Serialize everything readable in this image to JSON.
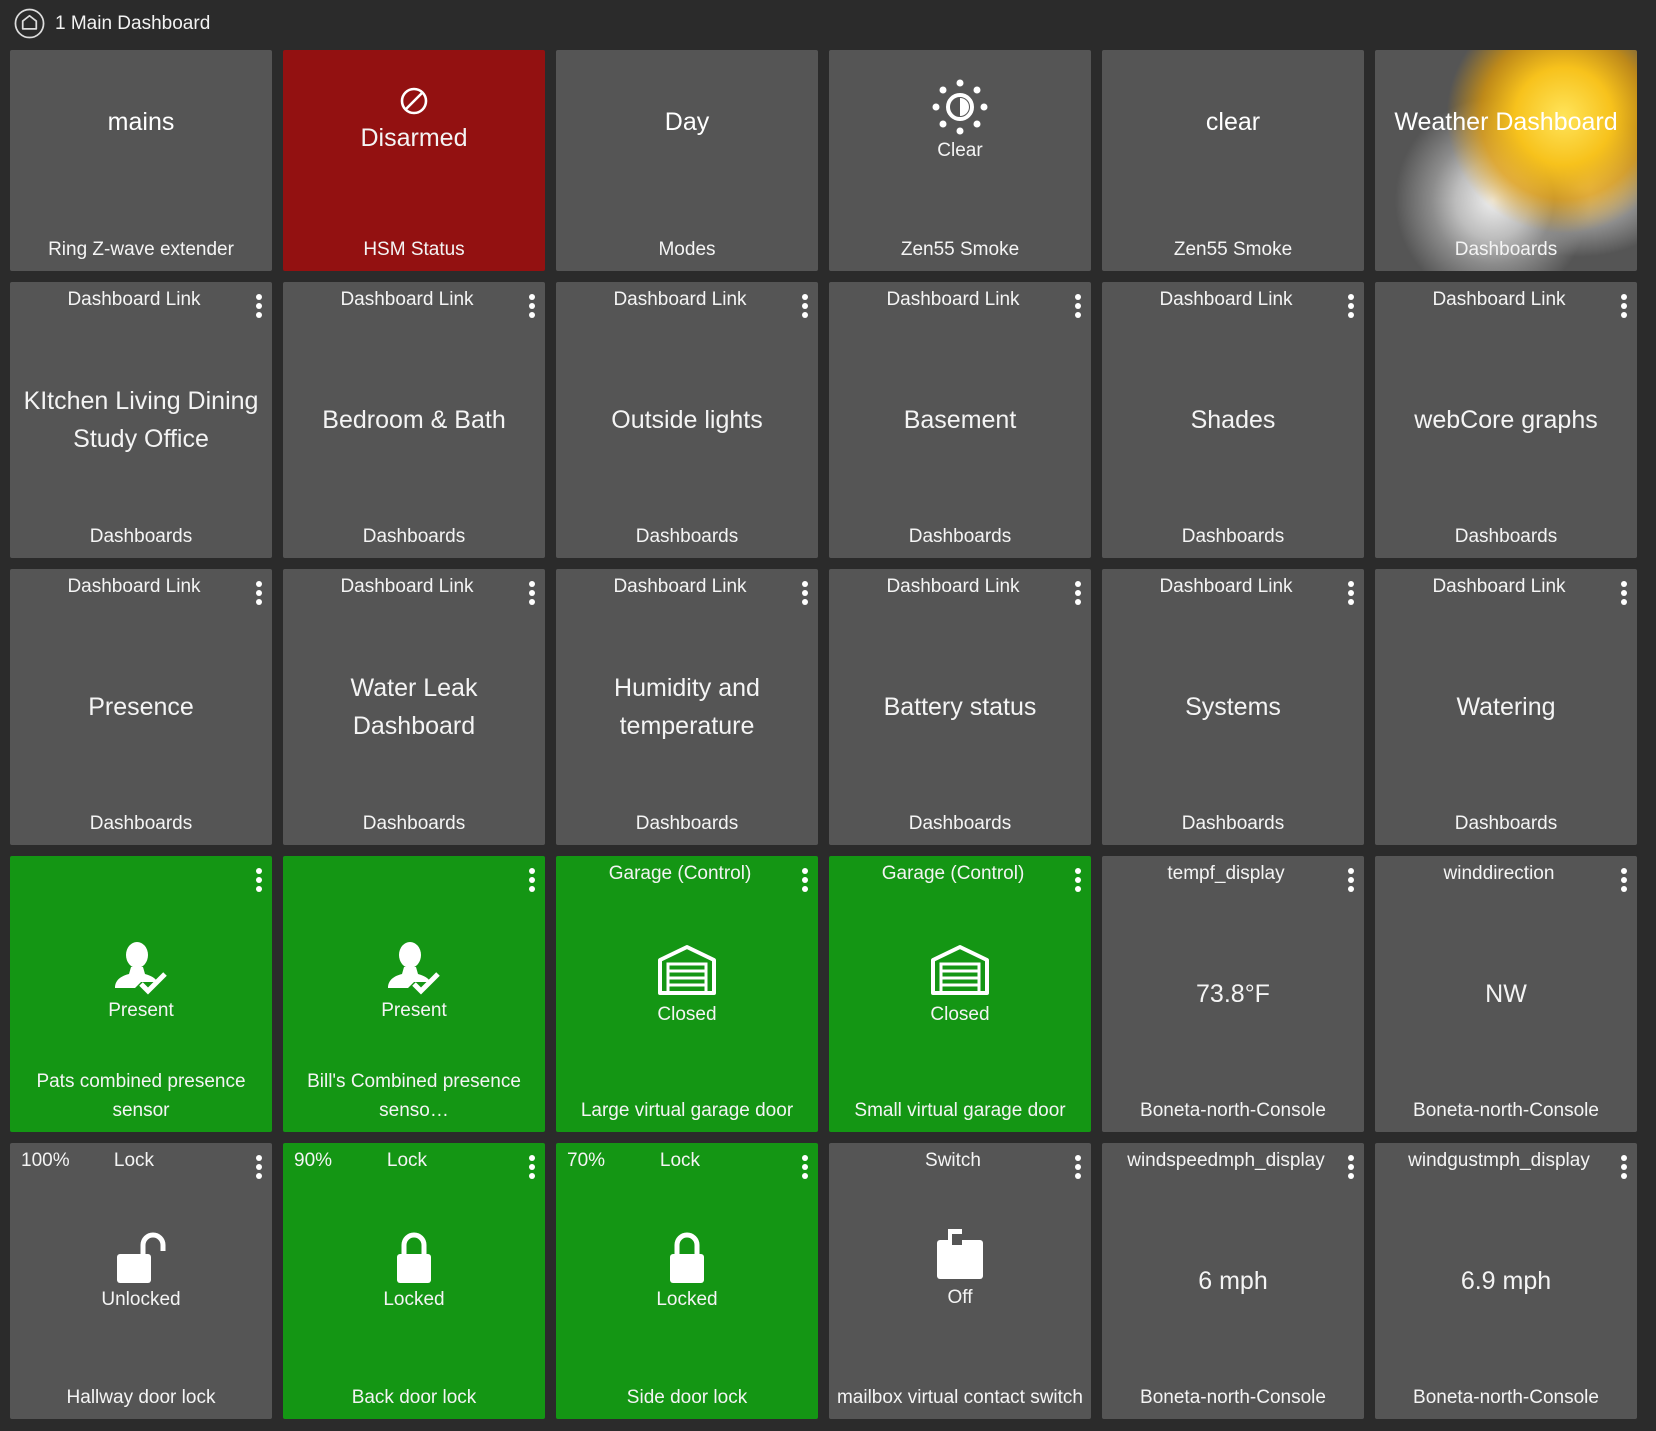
{
  "header": {
    "title": "1 Main Dashboard",
    "icon": "home-icon"
  },
  "tiles": {
    "t1": {
      "state": "mains",
      "name": "Ring Z-wave extender"
    },
    "t2": {
      "state": "Disarmed",
      "name": "HSM Status",
      "icon": "disarmed-icon",
      "color": "#931111"
    },
    "t3": {
      "state": "Day",
      "name": "Modes"
    },
    "t4": {
      "state": "Clear",
      "name": "Zen55 Smoke",
      "icon": "sun-icon"
    },
    "t5": {
      "state": "clear",
      "name": "Zen55 Smoke"
    },
    "t6": {
      "state": "Weather Dashboard",
      "name": "Dashboards",
      "icon": "weather-image"
    },
    "t7": {
      "label": "Dashboard Link",
      "state": "KItchen Living Dining Study Office",
      "name": "Dashboards"
    },
    "t8": {
      "label": "Dashboard Link",
      "state": "Bedroom & Bath",
      "name": "Dashboards"
    },
    "t9": {
      "label": "Dashboard Link",
      "state": "Outside lights",
      "name": "Dashboards"
    },
    "t10": {
      "label": "Dashboard Link",
      "state": "Basement",
      "name": "Dashboards"
    },
    "t11": {
      "label": "Dashboard Link",
      "state": "Shades",
      "name": "Dashboards"
    },
    "t12": {
      "label": "Dashboard Link",
      "state": "webCore graphs",
      "name": "Dashboards"
    },
    "t13": {
      "label": "Dashboard Link",
      "state": "Presence",
      "name": "Dashboards"
    },
    "t14": {
      "label": "Dashboard Link",
      "state": "Water Leak Dashboard",
      "name": "Dashboards"
    },
    "t15": {
      "label": "Dashboard Link",
      "state": "Humidity and temperature",
      "name": "Dashboards"
    },
    "t16": {
      "label": "Dashboard Link",
      "state": "Battery status",
      "name": "Dashboards"
    },
    "t17": {
      "label": "Dashboard Link",
      "state": "Systems",
      "name": "Dashboards"
    },
    "t18": {
      "label": "Dashboard Link",
      "state": "Watering",
      "name": "Dashboards"
    },
    "t19": {
      "state": "Present",
      "name": "Pats combined presence sensor",
      "icon": "person-check-icon",
      "color": "#149614"
    },
    "t20": {
      "state": "Present",
      "name": "Bill's Combined presence senso…",
      "icon": "person-check-icon",
      "color": "#149614"
    },
    "t21": {
      "label": "Garage (Control)",
      "state": "Closed",
      "name": "Large virtual garage door",
      "icon": "garage-icon",
      "color": "#149614"
    },
    "t22": {
      "label": "Garage (Control)",
      "state": "Closed",
      "name": "Small virtual garage door",
      "icon": "garage-icon",
      "color": "#149614"
    },
    "t23": {
      "label": "tempf_display",
      "state": "73.8°F",
      "name": "Boneta-north-Console"
    },
    "t24": {
      "label": "winddirection",
      "state": "NW",
      "name": "Boneta-north-Console"
    },
    "t25": {
      "pct": "100%",
      "label": "Lock",
      "state": "Unlocked",
      "name": "Hallway door lock",
      "icon": "unlock-icon"
    },
    "t26": {
      "pct": "90%",
      "label": "Lock",
      "state": "Locked",
      "name": "Back door lock",
      "icon": "lock-icon",
      "color": "#149614"
    },
    "t27": {
      "pct": "70%",
      "label": "Lock",
      "state": "Locked",
      "name": "Side door lock",
      "icon": "lock-icon",
      "color": "#149614"
    },
    "t28": {
      "label": "Switch",
      "state": "Off",
      "name": "mailbox virtual contact switch",
      "icon": "switch-off-icon"
    },
    "t29": {
      "label": "windspeedmph_display",
      "state": "6 mph",
      "name": "Boneta-north-Console"
    },
    "t30": {
      "label": "windgustmph_display",
      "state": "6.9 mph",
      "name": "Boneta-north-Console"
    }
  }
}
